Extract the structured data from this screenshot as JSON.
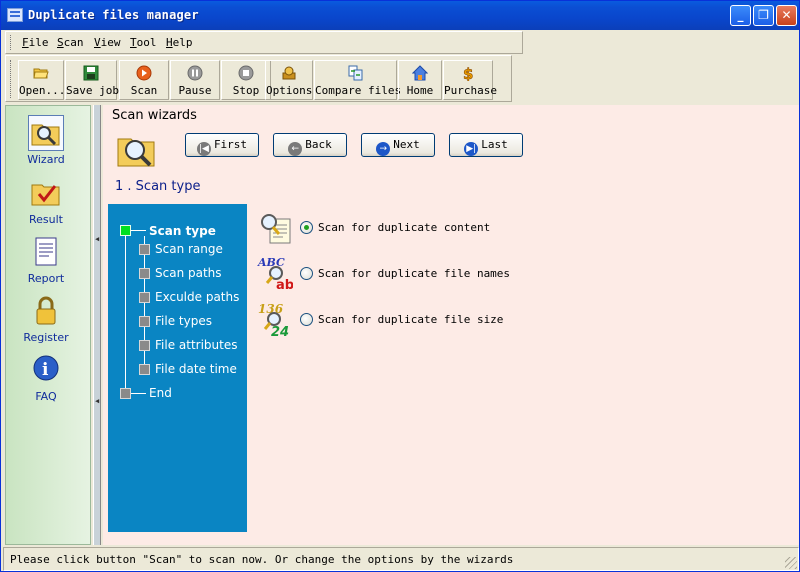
{
  "window": {
    "title": "Duplicate files manager"
  },
  "menu": {
    "items": [
      "File",
      "Scan",
      "View",
      "Tool",
      "Help"
    ]
  },
  "toolbar": {
    "buttons": [
      {
        "label": "Open...",
        "icon": "folder-open-icon"
      },
      {
        "label": "Save job",
        "icon": "floppy-disk-icon"
      },
      {
        "label": "Scan",
        "icon": "play-icon"
      },
      {
        "label": "Pause",
        "icon": "pause-icon"
      },
      {
        "label": "Stop",
        "icon": "stop-icon"
      },
      {
        "label": "Options",
        "icon": "options-icon"
      },
      {
        "label": "Compare files",
        "icon": "compare-icon"
      },
      {
        "label": "Home",
        "icon": "home-icon"
      },
      {
        "label": "Purchase",
        "icon": "dollar-icon"
      }
    ]
  },
  "sidebar": {
    "items": [
      {
        "label": "Wizard",
        "icon": "folder-search-icon",
        "selected": true
      },
      {
        "label": "Result",
        "icon": "folder-check-icon"
      },
      {
        "label": "Report",
        "icon": "report-icon"
      },
      {
        "label": "Register",
        "icon": "lock-icon"
      },
      {
        "label": "FAQ",
        "icon": "info-icon"
      }
    ]
  },
  "wizard": {
    "header": "Scan wizards",
    "nav": {
      "first": "First",
      "back": "Back",
      "next": "Next",
      "last": "Last"
    },
    "step_title": "1 . Scan type",
    "tree": [
      {
        "label": "Scan type",
        "current": true
      },
      {
        "label": "Scan range"
      },
      {
        "label": "Scan paths"
      },
      {
        "label": "Exculde paths"
      },
      {
        "label": "File types"
      },
      {
        "label": "File attributes"
      },
      {
        "label": "File date time"
      },
      {
        "label": "End"
      }
    ],
    "options": [
      {
        "label": "Scan for duplicate content",
        "checked": true,
        "icon": "content-search-icon"
      },
      {
        "label": "Scan for duplicate file names",
        "checked": false,
        "icon": "abc-search-icon",
        "icon_text": "ABC"
      },
      {
        "label": "Scan for duplicate file size",
        "checked": false,
        "icon": "number-search-icon",
        "icon_text": "136"
      }
    ]
  },
  "status": {
    "text": "Please click button \"Scan\" to scan now. Or change the options by the wizards"
  },
  "colors": {
    "tree_bg": "#0a85c3",
    "main_bg": "#fdebe6",
    "title_blue": "#0b4fd4"
  }
}
